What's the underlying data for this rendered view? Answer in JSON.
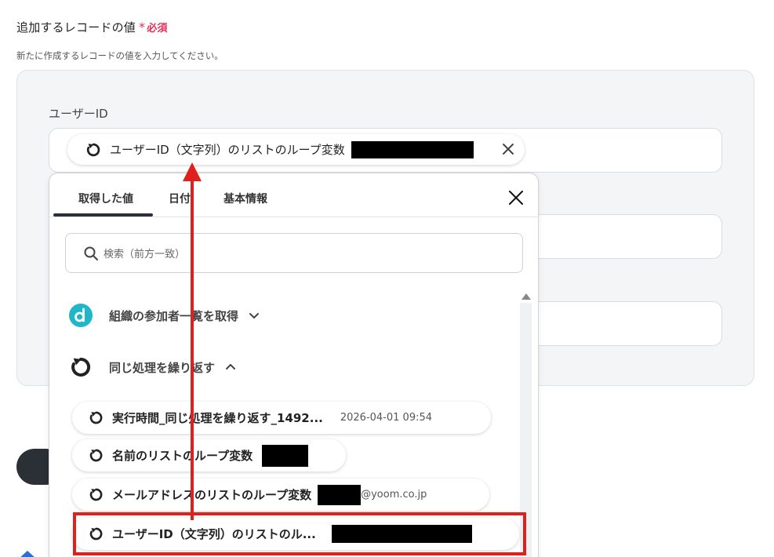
{
  "section": {
    "title": "追加するレコードの値",
    "required_star": "*",
    "required_text": "必須",
    "description": "新たに作成するレコードの値を入力してください。"
  },
  "field": {
    "label": "ユーザーID",
    "token_label": "ユーザーID（文字列）のリストのループ変数"
  },
  "popup": {
    "tabs": [
      {
        "label": "取得した値",
        "active": true
      },
      {
        "label": "日付"
      },
      {
        "label": "基本情報"
      }
    ],
    "search_placeholder": "検索（前方一致）",
    "groups": [
      {
        "label": "組織の参加者一覧を取得",
        "icon": "d-app-icon",
        "expanded": false
      },
      {
        "label": "同じ処理を繰り返す",
        "icon": "loop-icon",
        "expanded": true
      }
    ],
    "items": [
      {
        "label": "実行時間_同じ処理を繰り返す_1492...",
        "meta": "2026-04-01 09:54"
      },
      {
        "label": "名前のリストのループ変数",
        "meta": ""
      },
      {
        "label": "メールアドレスのリストのループ変数",
        "meta": "@yoom.co.jp"
      },
      {
        "label": "ユーザーID（文字列）のリストのル...",
        "meta": ""
      }
    ]
  },
  "colors": {
    "required": "#e0305a",
    "highlight": "#e0201c",
    "app_icon": "#1fb6c9",
    "dark": "#2b2f36"
  }
}
